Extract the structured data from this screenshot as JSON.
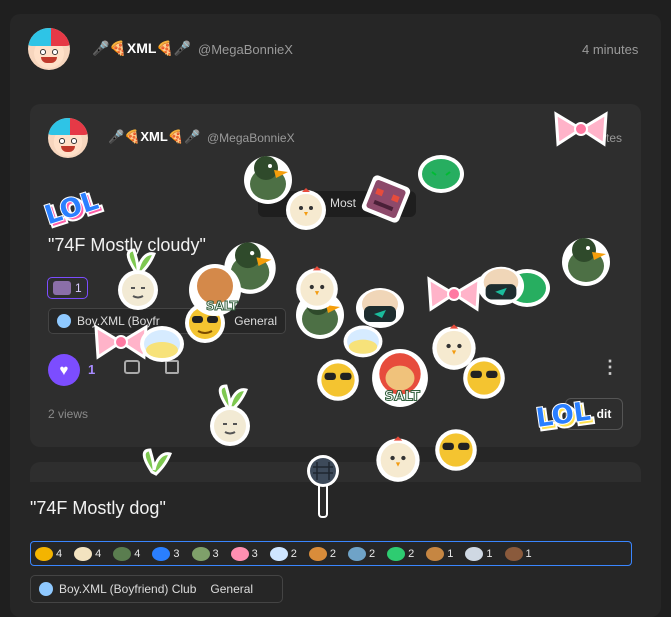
{
  "outer_post": {
    "author": "🎤🍕XML🍕🎤",
    "handle": "@MegaBonnieX",
    "time": "4 minutes",
    "text": "\"74F Mostly dog\"",
    "community": "Boy.XML (Boyfriend) Club",
    "channel": "General",
    "reactions": [
      {
        "icon": "sunglasses-emoji-icon",
        "count": "4",
        "color": "#f4b400"
      },
      {
        "icon": "chicken-icon",
        "count": "4",
        "color": "#f3e3c0"
      },
      {
        "icon": "duck-icon",
        "count": "4",
        "color": "#5a7d4f"
      },
      {
        "icon": "lol-icon",
        "count": "3",
        "color": "#2a7fff"
      },
      {
        "icon": "mask-duck-icon",
        "count": "3",
        "color": "#7fa06a"
      },
      {
        "icon": "bow-icon",
        "count": "3",
        "color": "#ff8fb1"
      },
      {
        "icon": "potion-icon",
        "count": "2",
        "color": "#cfe6ff"
      },
      {
        "icon": "salt-icon",
        "count": "2",
        "color": "#d98c3a"
      },
      {
        "icon": "eye-mask-icon",
        "count": "2",
        "color": "#6fa3c7"
      },
      {
        "icon": "slime-icon",
        "count": "2",
        "color": "#2ecc71"
      },
      {
        "icon": "cookie-icon",
        "count": "1",
        "color": "#c68642"
      },
      {
        "icon": "microphone-icon",
        "count": "1",
        "color": "#cfd8e3"
      },
      {
        "icon": "hair-icon",
        "count": "1",
        "color": "#8a5a3c"
      }
    ]
  },
  "inner_post": {
    "author": "🎤🍕XML🍕🎤",
    "handle": "@MegaBonnieX",
    "time_partial": "tes",
    "text": "\"74F Mostly cloudy\"",
    "reaction_count": "1",
    "like_count": "1",
    "community": "Boy.XML (Boyfr",
    "channel": "General",
    "views": "2 views",
    "edit_label": "dit",
    "floating_label": "Most"
  },
  "stickers": {
    "lol_text": "LOL",
    "salt_text": "SALT"
  }
}
